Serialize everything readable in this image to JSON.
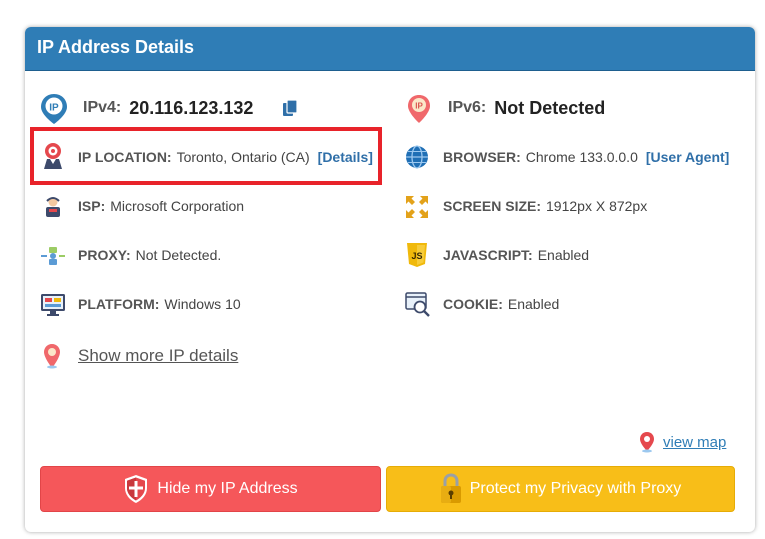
{
  "panel": {
    "title": "IP Address Details"
  },
  "ipv4": {
    "label": "IPv4:",
    "value": "20.116.123.132"
  },
  "ipv6": {
    "label": "IPv6:",
    "value": "Not Detected"
  },
  "location": {
    "label": "IP LOCATION:",
    "value": "Toronto, Ontario (CA)",
    "link": "[Details]"
  },
  "browser": {
    "label": "BROWSER:",
    "value": "Chrome 133.0.0.0",
    "link": "[User Agent]"
  },
  "isp": {
    "label": "ISP:",
    "value": "Microsoft Corporation"
  },
  "screen": {
    "label": "SCREEN SIZE:",
    "value": "1912px X 872px"
  },
  "proxy": {
    "label": "PROXY:",
    "value": "Not Detected."
  },
  "javascript": {
    "label": "JAVASCRIPT:",
    "value": "Enabled"
  },
  "platform": {
    "label": "PLATFORM:",
    "value": "Windows 10"
  },
  "cookie": {
    "label": "COOKIE:",
    "value": "Enabled"
  },
  "more_link": "Show more IP details",
  "map_link": "view map",
  "buttons": {
    "hide_ip": "Hide my IP Address",
    "protect_privacy": "Protect my Privacy with Proxy"
  },
  "colors": {
    "header": "#2f7db6",
    "highlight": "#e8232a",
    "hide_button": "#f5575a",
    "proxy_button": "#f8be18",
    "link": "#2f6fa8"
  },
  "icons": [
    "ip-pin-icon",
    "copy-icon",
    "ipv6-pin-icon",
    "location-person-icon",
    "globe-icon",
    "isp-person-icon",
    "screen-expand-icon",
    "proxy-icon",
    "javascript-icon",
    "platform-monitor-icon",
    "cookie-search-icon",
    "map-pin-icon",
    "shield-icon",
    "lock-icon"
  ]
}
